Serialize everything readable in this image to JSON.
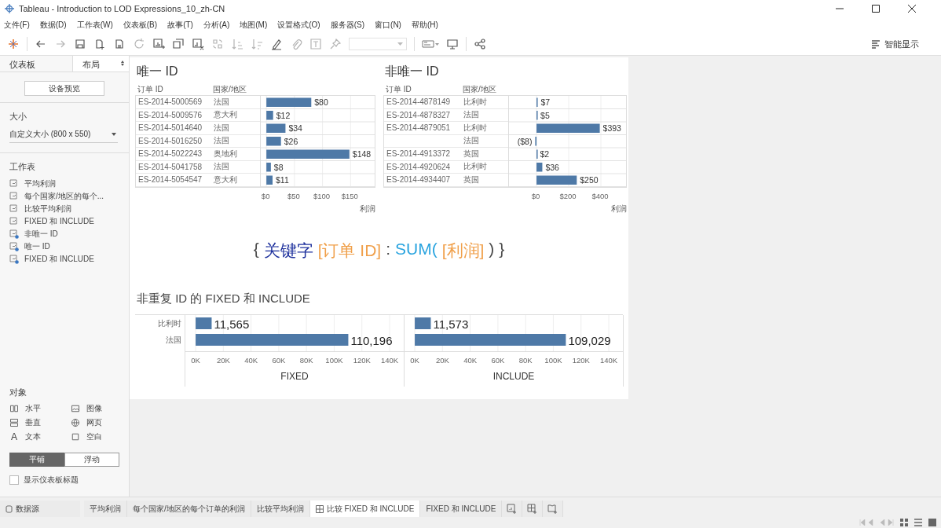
{
  "window": {
    "title": "Tableau - Introduction to LOD Expressions_10_zh-CN"
  },
  "menu": [
    "文件(F)",
    "数据(D)",
    "工作表(W)",
    "仪表板(B)",
    "故事(T)",
    "分析(A)",
    "地图(M)",
    "设置格式(O)",
    "服务器(S)",
    "窗口(N)",
    "帮助(H)"
  ],
  "toolbar": {
    "smart_show": "智能显示"
  },
  "sidebar": {
    "tabs": [
      {
        "label": "仪表板",
        "selected": true
      },
      {
        "label": "布局",
        "selected": false
      }
    ],
    "device_preview": "设备预览",
    "size_heading": "大小",
    "size_value": "自定义大小 (800 x 550)",
    "sheets_heading": "工作表",
    "sheets": [
      {
        "label": "平均利润",
        "kind": "sheet"
      },
      {
        "label": "每个国家/地区的每个...",
        "kind": "sheet"
      },
      {
        "label": "比较平均利润",
        "kind": "sheet"
      },
      {
        "label": "FIXED 和 INCLUDE",
        "kind": "sheet"
      },
      {
        "label": "非唯一 ID",
        "kind": "used"
      },
      {
        "label": "唯一 ID",
        "kind": "used"
      },
      {
        "label": "FIXED 和 INCLUDE",
        "kind": "used"
      }
    ],
    "objects_heading": "对象",
    "objects": [
      {
        "label": "水平",
        "kind": "horizontal"
      },
      {
        "label": "图像",
        "kind": "image"
      },
      {
        "label": "垂直",
        "kind": "vertical"
      },
      {
        "label": "网页",
        "kind": "web"
      },
      {
        "label": "文本",
        "kind": "text",
        "icon": "A"
      },
      {
        "label": "空白",
        "kind": "blank"
      }
    ],
    "layout_modes": [
      {
        "label": "平铺",
        "selected": true
      },
      {
        "label": "浮动",
        "selected": false
      }
    ],
    "show_title": {
      "label": "显示仪表板标题",
      "checked": false
    }
  },
  "dashboard": {
    "tables": [
      {
        "title": "唯一 ID",
        "columns": [
          "订单 ID",
          "国家/地区"
        ],
        "rows": [
          {
            "order_id": "ES-2014-5000569",
            "country": "法国"
          },
          {
            "order_id": "ES-2014-5009576",
            "country": "意大利"
          },
          {
            "order_id": "ES-2014-5014640",
            "country": "法国"
          },
          {
            "order_id": "ES-2014-5016250",
            "country": "法国"
          },
          {
            "order_id": "ES-2014-5022243",
            "country": "奥地利"
          },
          {
            "order_id": "ES-2014-5041758",
            "country": "法国"
          },
          {
            "order_id": "ES-2014-5054547",
            "country": "意大利"
          }
        ],
        "chart_data": {
          "type": "bar",
          "orientation": "horizontal",
          "xlabel": "利润",
          "grid": true,
          "xlim": [
            -10,
            193
          ],
          "values": [
            80,
            12,
            34,
            26,
            148,
            8,
            11
          ],
          "value_labels": [
            "$80",
            "$12",
            "$34",
            "$26",
            "$148",
            "$8",
            "$11"
          ],
          "xticks": [
            {
              "value": 0,
              "label": "$0"
            },
            {
              "value": 50,
              "label": "$50"
            },
            {
              "value": 100,
              "label": "$100"
            },
            {
              "value": 150,
              "label": "$150"
            }
          ]
        }
      },
      {
        "title": "非唯一 ID",
        "columns": [
          "订单 ID",
          "国家/地区"
        ],
        "rows": [
          {
            "order_id": "ES-2014-4878149",
            "country": "比利时"
          },
          {
            "order_id": "ES-2014-4878327",
            "country": "法国"
          },
          {
            "order_id": "ES-2014-4879051",
            "country": "比利时"
          },
          {
            "country": "法国"
          },
          {
            "order_id": "ES-2014-4913372",
            "country": "英国"
          },
          {
            "order_id": "ES-2014-4920624",
            "country": "比利时"
          },
          {
            "order_id": "ES-2014-4934407",
            "country": "英国"
          }
        ],
        "chart_data": {
          "type": "bar",
          "orientation": "horizontal",
          "xlabel": "利润",
          "grid": true,
          "xlim": [
            -171,
            556
          ],
          "values": [
            7,
            5,
            393,
            -8,
            2,
            36,
            250
          ],
          "value_labels": [
            "$7",
            "$5",
            "$393",
            "($8)",
            "$2",
            "$36",
            "$250"
          ],
          "xticks": [
            {
              "value": 0,
              "label": "$0"
            },
            {
              "value": 200,
              "label": "$200"
            },
            {
              "value": 400,
              "label": "$400"
            }
          ]
        }
      }
    ],
    "formula": [
      {
        "text": "{",
        "color": "#4a4a4a"
      },
      {
        "text": "关键字",
        "color": "#1c2f9c"
      },
      {
        "text": "[订单 ID]",
        "color": "#f0a04b"
      },
      {
        "text": ":",
        "color": "#4a4a4a"
      },
      {
        "text": "SUM(",
        "color": "#2aa4df"
      },
      {
        "text": "[利润]",
        "color": "#f0a04b"
      },
      {
        "text": ")",
        "color": "#4a4a4a"
      },
      {
        "text": "}",
        "color": "#4a4a4a"
      }
    ],
    "comparison": {
      "title": "非重复 ID 的 FIXED 和 INCLUDE",
      "charts": [
        {
          "chart_data": {
            "type": "bar",
            "orientation": "horizontal",
            "xlabel": "FIXED",
            "grid": true,
            "categories": [
              "比利时",
              "法国"
            ],
            "xlim": [
              -7400,
              150200
            ],
            "values": [
              11565,
              110196
            ],
            "value_labels": [
              "11,565",
              "110,196"
            ],
            "xticks": [
              {
                "value": 0,
                "label": "0K"
              },
              {
                "value": 20000,
                "label": "20K"
              },
              {
                "value": 40000,
                "label": "40K"
              },
              {
                "value": 60000,
                "label": "60K"
              },
              {
                "value": 80000,
                "label": "80K"
              },
              {
                "value": 100000,
                "label": "100K"
              },
              {
                "value": 120000,
                "label": "120K"
              },
              {
                "value": 140000,
                "label": "140K"
              }
            ]
          }
        },
        {
          "chart_data": {
            "type": "bar",
            "orientation": "horizontal",
            "xlabel": "INCLUDE",
            "grid": true,
            "categories": [
              null,
              null
            ],
            "xlim": [
              -7400,
              150200
            ],
            "values": [
              11573,
              109029
            ],
            "value_labels": [
              "11,573",
              "109,029"
            ],
            "xticks": [
              {
                "value": 0,
                "label": "0K"
              },
              {
                "value": 20000,
                "label": "20K"
              },
              {
                "value": 40000,
                "label": "40K"
              },
              {
                "value": 60000,
                "label": "60K"
              },
              {
                "value": 80000,
                "label": "80K"
              },
              {
                "value": 100000,
                "label": "100K"
              },
              {
                "value": 120000,
                "label": "120K"
              },
              {
                "value": 140000,
                "label": "140K"
              }
            ]
          }
        }
      ]
    }
  },
  "sheet_tabs": [
    {
      "label": "数据源",
      "kind": "datasource",
      "selected": false
    },
    {
      "label": "平均利润",
      "kind": "worksheet",
      "selected": false
    },
    {
      "label": "每个国家/地区的每个订单的利润",
      "kind": "worksheet",
      "selected": false
    },
    {
      "label": "比较平均利润",
      "kind": "worksheet",
      "selected": false
    },
    {
      "label": "比较 FIXED 和 INCLUDE",
      "kind": "dashboard",
      "selected": true
    },
    {
      "label": "FIXED 和 INCLUDE",
      "kind": "worksheet",
      "selected": false
    }
  ]
}
